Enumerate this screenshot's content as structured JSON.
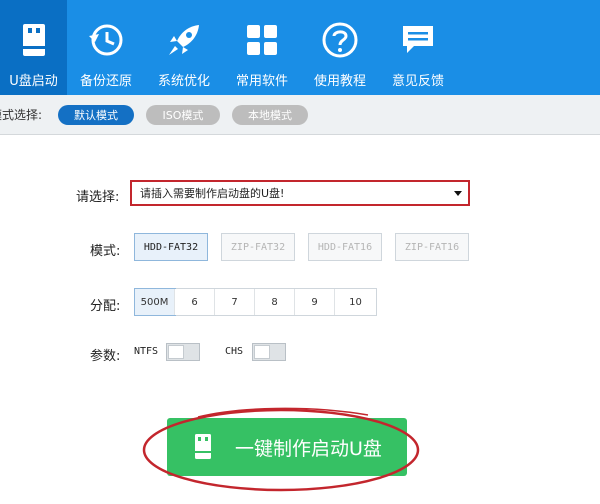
{
  "toolbar": {
    "items": [
      {
        "label": "U盘启动",
        "icon": "usb-drive-icon",
        "active": true
      },
      {
        "label": "备份还原",
        "icon": "restore-clock-icon",
        "active": false
      },
      {
        "label": "系统优化",
        "icon": "rocket-icon",
        "active": false
      },
      {
        "label": "常用软件",
        "icon": "apps-grid-icon",
        "active": false
      },
      {
        "label": "使用教程",
        "icon": "help-question-icon",
        "active": false
      },
      {
        "label": "意见反馈",
        "icon": "feedback-chat-icon",
        "active": false
      }
    ],
    "bg_color": "#1a8ee6",
    "active_color": "#0a6fc4"
  },
  "mode_bar": {
    "label": "模式选择:",
    "modes": [
      {
        "label": "默认模式",
        "selected": true
      },
      {
        "label": "ISO模式",
        "selected": false
      },
      {
        "label": "本地模式",
        "selected": false
      }
    ]
  },
  "form": {
    "select_label": "请选择:",
    "select_value": "请插入需要制作启动盘的U盘!",
    "format_label": "模式:",
    "formats": [
      {
        "label": "HDD-FAT32",
        "selected": true
      },
      {
        "label": "ZIP-FAT32",
        "selected": false
      },
      {
        "label": "HDD-FAT16",
        "selected": false
      },
      {
        "label": "ZIP-FAT16",
        "selected": false
      }
    ],
    "partition_label": "分配:",
    "sizes": [
      {
        "label": "500M",
        "selected": true
      },
      {
        "label": "6",
        "selected": false
      },
      {
        "label": "7",
        "selected": false
      },
      {
        "label": "8",
        "selected": false
      },
      {
        "label": "9",
        "selected": false
      },
      {
        "label": "10",
        "selected": false
      }
    ],
    "params_label": "参数:",
    "toggles": [
      {
        "label": "NTFS",
        "on": false
      },
      {
        "label": "CHS",
        "on": false
      }
    ]
  },
  "action": {
    "button_label": "一键制作启动U盘",
    "button_color": "#36c164",
    "annotation_color": "#c3262d"
  }
}
